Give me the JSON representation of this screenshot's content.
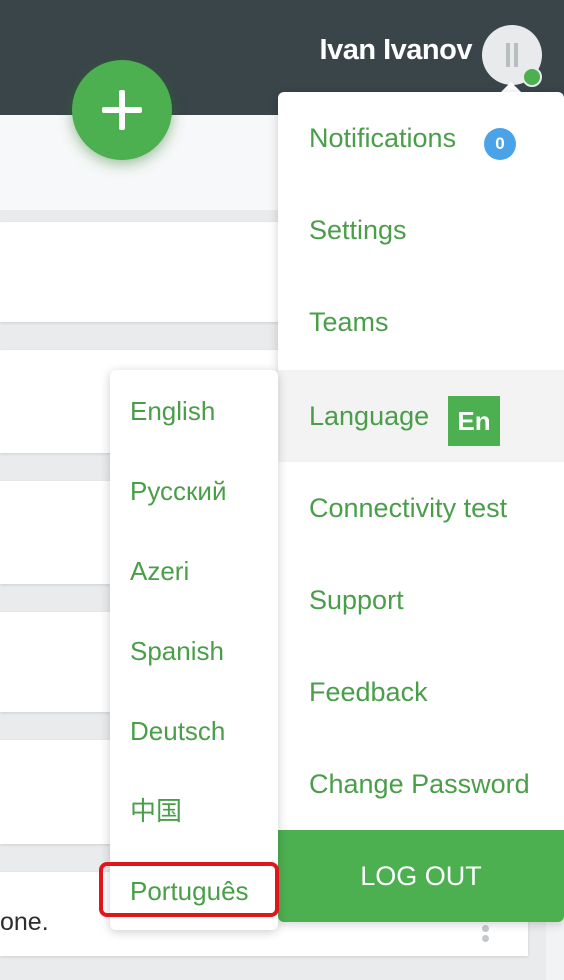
{
  "header": {
    "user_name": "Ivan Ivanov",
    "avatar_icon": "pause-icon",
    "status_color": "#4caf50"
  },
  "fab": {
    "icon": "plus-icon"
  },
  "background": {
    "card_text_fragment": "one."
  },
  "user_menu": {
    "items": [
      {
        "label": "Notifications",
        "badge": "0"
      },
      {
        "label": "Settings"
      },
      {
        "label": "Teams"
      },
      {
        "label": "Language",
        "badge": "En",
        "active": true
      },
      {
        "label": "Connectivity test"
      },
      {
        "label": "Support"
      },
      {
        "label": "Feedback"
      },
      {
        "label": "Change Password"
      }
    ],
    "logout_label": "LOG OUT"
  },
  "language_menu": {
    "items": [
      "English",
      "Русский",
      "Azeri",
      "Spanish",
      "Deutsch",
      "中国",
      "Português"
    ],
    "highlighted": "Português"
  },
  "colors": {
    "accent": "#4caf50",
    "text_green": "#4a9e4a",
    "topbar": "#3a4549",
    "badge_blue": "#4aa3e8",
    "highlight_red": "#e0161c"
  }
}
